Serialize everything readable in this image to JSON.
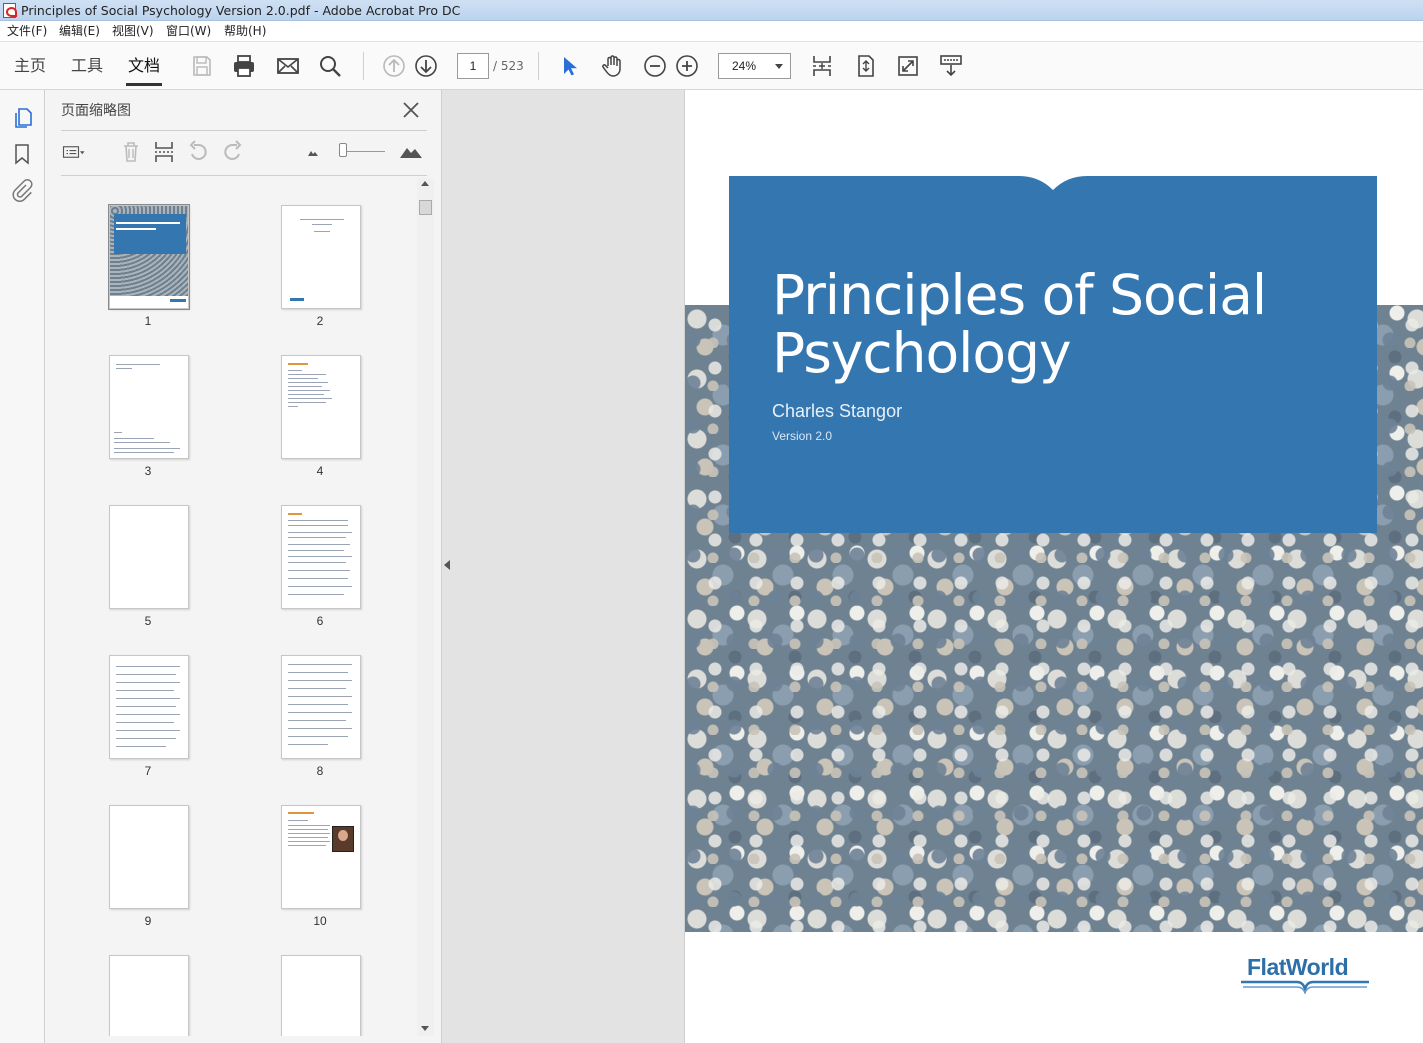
{
  "window": {
    "title": "Principles of Social Psychology Version 2.0.pdf - Adobe Acrobat Pro DC"
  },
  "menu": [
    "文件(F)",
    "编辑(E)",
    "视图(V)",
    "窗口(W)",
    "帮助(H)"
  ],
  "nav_tabs": [
    "主页",
    "工具",
    "文档"
  ],
  "toolbar": {
    "current_page": "1",
    "total_pages": "/ 523",
    "zoom": "24%",
    "icons": [
      "save-icon",
      "print-icon",
      "email-icon",
      "search-icon",
      "previous-page-icon",
      "next-page-icon",
      "select-arrow-icon",
      "hand-icon",
      "zoom-out-icon",
      "zoom-in-icon",
      "scroll-mode-icon",
      "fit-page-icon",
      "full-screen-icon",
      "read-mode-icon"
    ]
  },
  "left_rail": {
    "icons": [
      "page-thumbnails-icon",
      "bookmark-icon",
      "attachment-icon"
    ]
  },
  "thumbnail_panel": {
    "title": "页面缩略图",
    "pages": [
      "1",
      "2",
      "3",
      "4",
      "5",
      "6",
      "7",
      "8",
      "9",
      "10"
    ]
  },
  "document": {
    "title": "Principles of Social Psychology",
    "author": "Charles Stangor",
    "version": "Version 2.0",
    "brand": "FlatWorld",
    "accent_color": "#3376b0"
  }
}
